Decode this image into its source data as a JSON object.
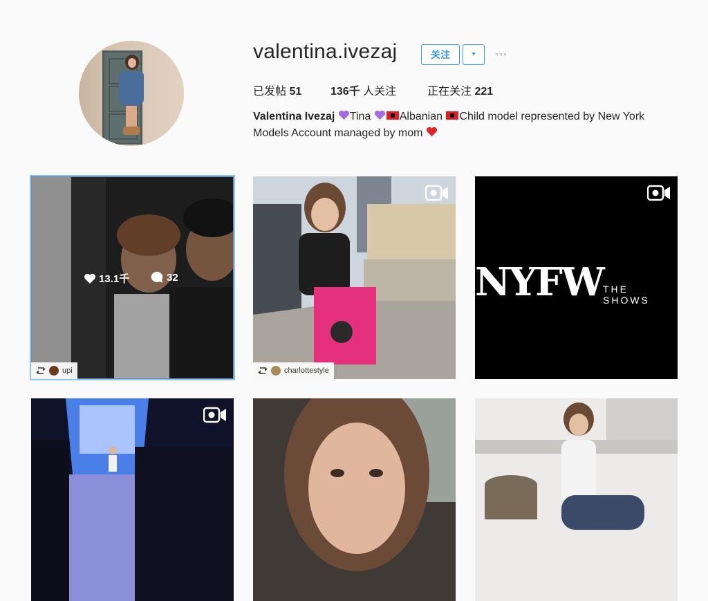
{
  "profile": {
    "username": "valentina.ivezaj",
    "follow_label": "关注",
    "dropdown_glyph": "▾",
    "more_glyph": "◦◦◦",
    "stats": {
      "posts_label": "已发帖",
      "posts_count": "51",
      "followers_count": "136千",
      "followers_label": "人关注",
      "following_label": "正在关注",
      "following_count": "221"
    },
    "bio": {
      "full_name": "Valentina Ivezaj",
      "part1": "Tina",
      "part2": "Albanian",
      "part3": "Child model represented by New York Models Account managed by mom"
    }
  },
  "posts": [
    {
      "type": "image",
      "hover": true,
      "likes": "13.1千",
      "comments": "32",
      "credit": "upi"
    },
    {
      "type": "video",
      "credit": "charlottestyle"
    },
    {
      "type": "video",
      "title_text": "NYFW",
      "sub_text": "THE SHOWS"
    },
    {
      "type": "video"
    },
    {
      "type": "image"
    },
    {
      "type": "image"
    }
  ],
  "icons": {
    "heart": "heart-icon",
    "comment": "comment-bubble-icon",
    "video": "video-camera-icon",
    "repost": "repost-icon"
  },
  "colors": {
    "accent": "#3897f0",
    "text": "#262626",
    "background": "#fafafa"
  }
}
